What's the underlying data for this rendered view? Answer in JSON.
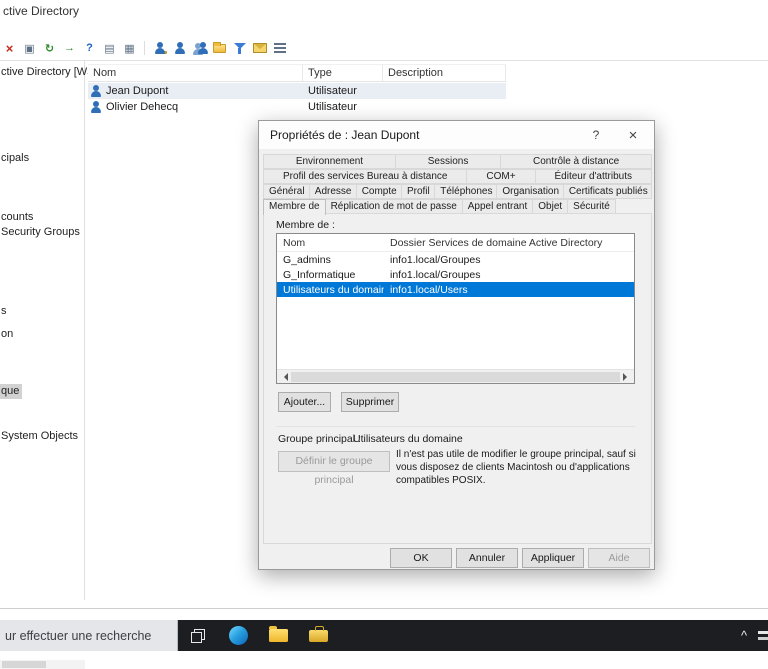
{
  "colors": {
    "selection-blue": "#0078d7",
    "row-selected": "#e9eef5",
    "tree-selected": "#d2d2d2",
    "taskbar-bg": "#1c1e22"
  },
  "window": {
    "title": "ctive Directory",
    "toolbar_icons": [
      {
        "name": "delete-icon",
        "glyph": "×"
      },
      {
        "name": "properties-icon",
        "glyph": "▣"
      },
      {
        "name": "refresh-icon",
        "glyph": "↻"
      },
      {
        "name": "export-list-icon",
        "glyph": "→"
      },
      {
        "name": "help-icon",
        "glyph": "?"
      },
      {
        "name": "list-view-icon",
        "glyph": "▤"
      },
      {
        "name": "report-view-icon",
        "glyph": "▦"
      }
    ],
    "action_icon_names": [
      "delegate-control-icon",
      "new-user-icon",
      "new-group-icon",
      "new-ou-icon",
      "filter-icon",
      "mail-icon",
      "view-options-icon"
    ]
  },
  "tree": {
    "items": [
      {
        "label": "ctive Directory [WS",
        "selected": false
      },
      {
        "label": "cipals",
        "selected": false
      },
      {
        "label": "counts",
        "selected": false
      },
      {
        "label": "Security Groups",
        "selected": false
      },
      {
        "label": "s",
        "selected": false
      },
      {
        "label": "on",
        "selected": false
      },
      {
        "label": "que",
        "selected": true
      },
      {
        "label": "System Objects",
        "selected": false
      }
    ]
  },
  "list": {
    "columns": [
      "Nom",
      "Type",
      "Description"
    ],
    "rows": [
      {
        "name": "Jean Dupont",
        "type": "Utilisateur",
        "description": "",
        "selected": true
      },
      {
        "name": "Olivier Dehecq",
        "type": "Utilisateur",
        "description": "",
        "selected": false
      }
    ]
  },
  "dialog": {
    "title": "Propriétés de : Jean Dupont",
    "help_glyph": "?",
    "close_glyph": "×",
    "tab_rows": [
      [
        "Environnement",
        "Sessions",
        "Contrôle à distance"
      ],
      [
        "Profil des services Bureau à distance",
        "COM+",
        "Éditeur d'attributs"
      ],
      [
        "Général",
        "Adresse",
        "Compte",
        "Profil",
        "Téléphones",
        "Organisation",
        "Certificats publiés"
      ],
      [
        "Membre de",
        "Réplication de mot de passe",
        "Appel entrant",
        "Objet",
        "Sécurité"
      ]
    ],
    "active_tab": "Membre de",
    "member_of_label": "Membre de :",
    "member_columns": [
      "Nom",
      "Dossier Services de domaine Active Directory"
    ],
    "members": [
      {
        "name": "G_admins",
        "folder": "info1.local/Groupes",
        "selected": false
      },
      {
        "name": "G_Informatique",
        "folder": "info1.local/Groupes",
        "selected": false
      },
      {
        "name": "Utilisateurs du domaine",
        "folder": "info1.local/Users",
        "selected": true
      }
    ],
    "add_button": "Ajouter...",
    "remove_button": "Supprimer",
    "primary_group_label": "Groupe principal :",
    "primary_group_value": "Utilisateurs du domaine",
    "set_primary_button": "Définir le groupe principal",
    "primary_note": "Il n'est pas utile de modifier le groupe principal, sauf si vous disposez de clients Macintosh ou d'applications compatibles POSIX.",
    "ok": "OK",
    "cancel": "Annuler",
    "apply": "Appliquer",
    "help": "Aide"
  },
  "taskbar": {
    "search_text": "ur effectuer une recherche",
    "chevron": "^",
    "icon_names": [
      "task-view-icon",
      "edge-icon",
      "file-explorer-icon",
      "toolbox-icon"
    ]
  }
}
